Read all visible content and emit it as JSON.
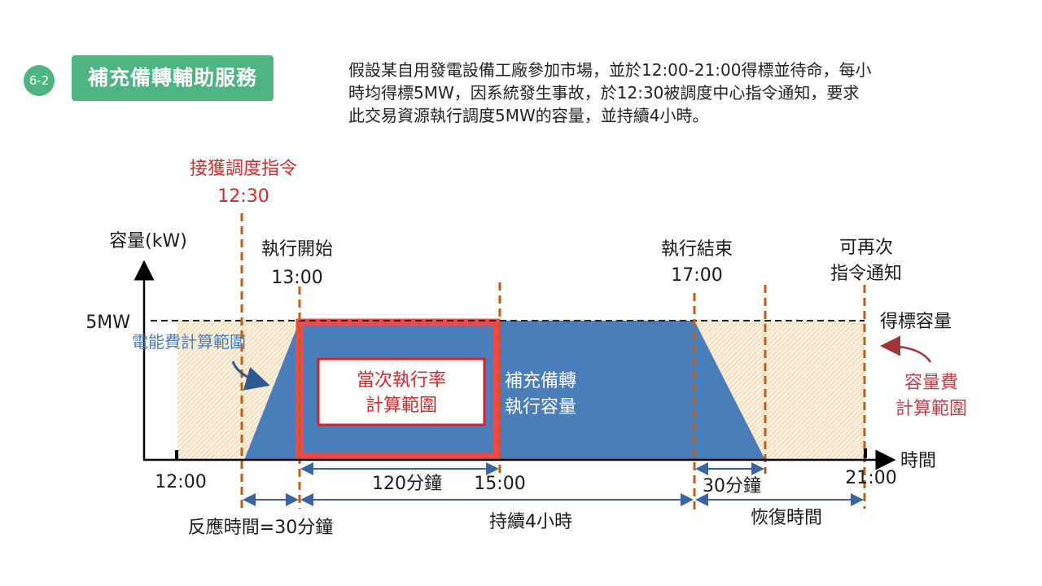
{
  "header": {
    "section_number": "6-2",
    "title": "補充備轉輔助服務",
    "description_lines": [
      "假設某自用發電設備工廠參加市場，並於12:00-21:00得標並待命，每小",
      "時均得標5MW，因系統發生事故，於12:30被調度中心指令通知，要求",
      "此交易資源執行調度5MW的容量，並持續4小時。"
    ]
  },
  "diagram": {
    "y_axis_label": "容量(kW)",
    "x_axis_label": "時間",
    "capacity_label": "5MW",
    "dispatch_label": "接獲調度指令",
    "dispatch_time": "12:30",
    "start_label": "執行開始",
    "start_time": "13:00",
    "end_label": "執行結束",
    "end_time": "17:00",
    "renotify_line1": "可再次",
    "renotify_line2": "指令通知",
    "awarded_capacity": "得標容量",
    "energy_fee_range": "電能費計算範圍",
    "exec_rate_line1": "當次執行率",
    "exec_rate_line2": "計算範圍",
    "exec_capacity_line1": "補充備轉",
    "exec_capacity_line2": "執行容量",
    "capacity_fee_line1": "容量費",
    "capacity_fee_line2": "計算範圍",
    "tick_1200": "12:00",
    "tick_1500": "15:00",
    "tick_2100": "21:00",
    "span_120": "120分鐘",
    "span_30": "30分鐘",
    "response_time": "反應時間=30分鐘",
    "duration": "持續4小時",
    "recovery_time": "恢復時間",
    "colors": {
      "blue": "#4A7EBB",
      "red": "#F04848",
      "brown": "#C55A11",
      "tan": "#FBE9C8",
      "green": "#4DB482"
    }
  }
}
